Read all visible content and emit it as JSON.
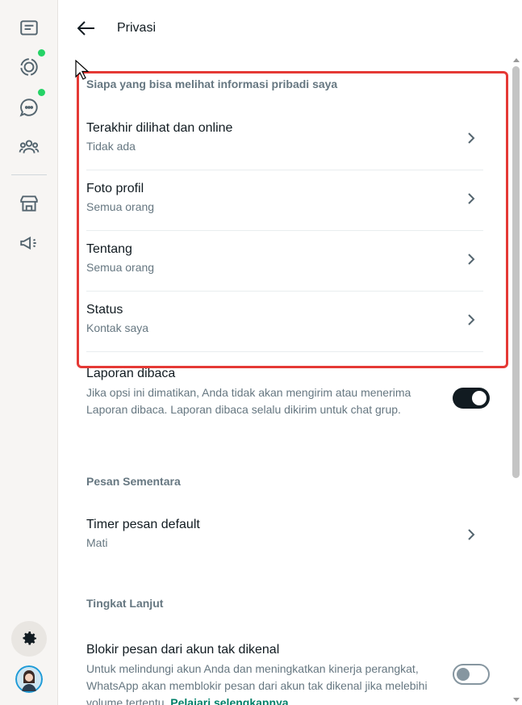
{
  "header": {
    "title": "Privasi"
  },
  "section_private": {
    "label": "Siapa yang bisa melihat informasi pribadi saya",
    "items": [
      {
        "title": "Terakhir dilihat dan online",
        "subtitle": "Tidak ada"
      },
      {
        "title": "Foto profil",
        "subtitle": "Semua orang"
      },
      {
        "title": "Tentang",
        "subtitle": "Semua orang"
      },
      {
        "title": "Status",
        "subtitle": "Kontak saya"
      }
    ]
  },
  "read_receipts": {
    "title": "Laporan dibaca",
    "description": "Jika opsi ini dimatikan, Anda tidak akan mengirim atau menerima Laporan dibaca. Laporan dibaca selalu dikirim untuk chat grup.",
    "enabled": true
  },
  "section_disappearing": {
    "label": "Pesan Sementara",
    "timer_title": "Timer pesan default",
    "timer_value": "Mati"
  },
  "section_advanced": {
    "label": "Tingkat Lanjut",
    "block_title": "Blokir pesan dari akun tak dikenal",
    "block_description": "Untuk melindungi akun Anda dan meningkatkan kinerja perangkat, WhatsApp akan memblokir pesan dari akun tak dikenal jika melebihi volume tertentu.",
    "learn_more": "Pelajari selengkapnya",
    "enabled": false
  },
  "colors": {
    "accent": "#008069",
    "badge": "#25d366",
    "highlight": "#e53935"
  },
  "icons": [
    "chats-icon",
    "status-icon",
    "channels-icon",
    "communities-icon",
    "business-tools-icon",
    "broadcast-icon",
    "settings-icon",
    "back-arrow-icon",
    "chevron-right-icon"
  ]
}
